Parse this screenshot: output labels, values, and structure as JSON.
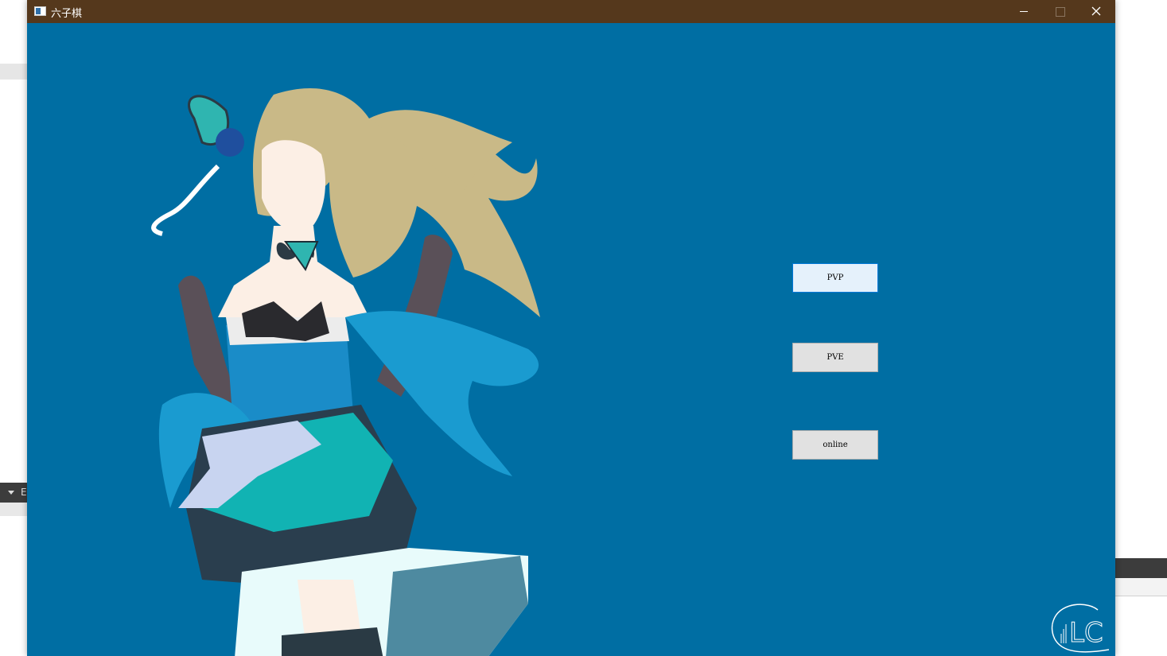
{
  "window": {
    "title": "六子棋",
    "title_bar_color": "#55381c",
    "background_color": "#006ea3"
  },
  "menu": {
    "pvp_label": "PVP",
    "pve_label": "PVE",
    "online_label": "online"
  },
  "background_fragment": {
    "left_label": "E"
  },
  "logo": {
    "text": "LC"
  },
  "illustration": {
    "subject": "anime-girl-silhouette",
    "hair_color": "#c9b987",
    "dress_color": "#1a9bd0"
  }
}
